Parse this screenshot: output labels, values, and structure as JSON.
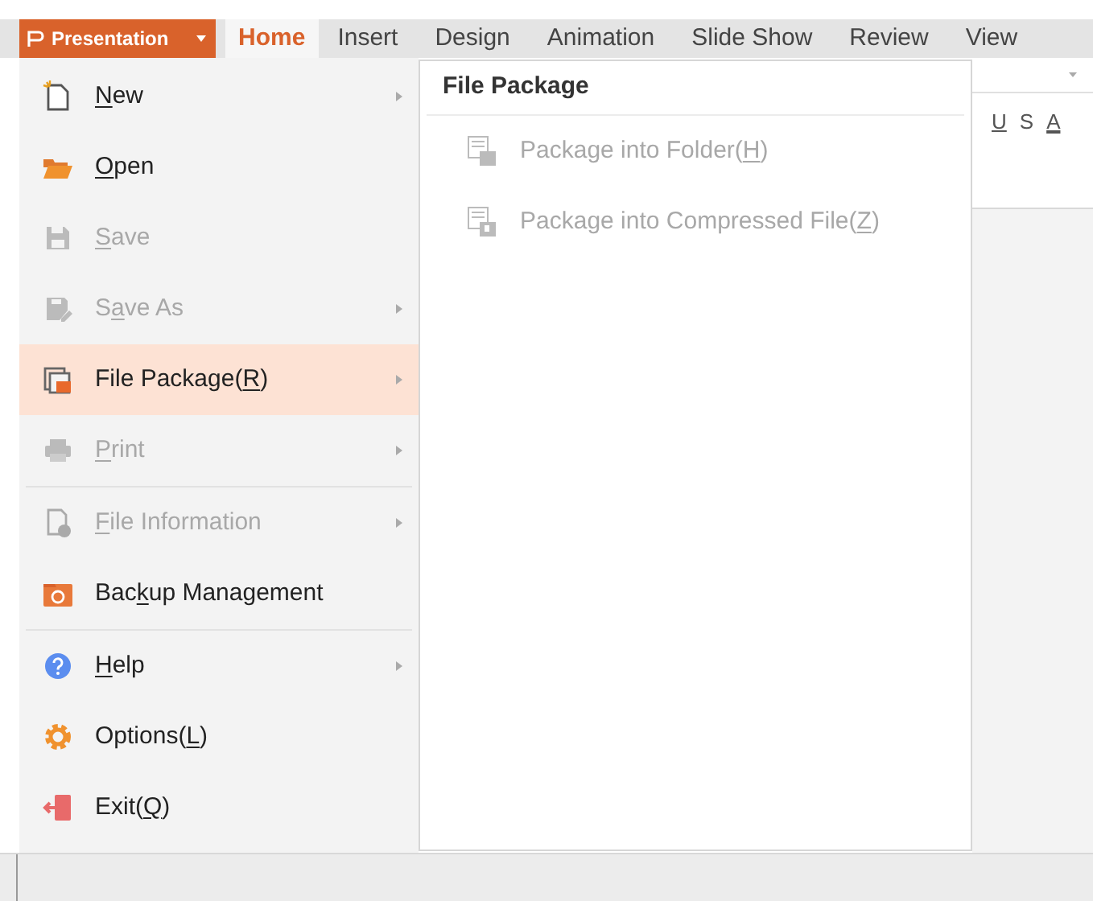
{
  "app_menu": {
    "label": "Presentation"
  },
  "tabs": [
    {
      "label": "Home",
      "selected": true
    },
    {
      "label": "Insert",
      "selected": false
    },
    {
      "label": "Design",
      "selected": false
    },
    {
      "label": "Animation",
      "selected": false
    },
    {
      "label": "Slide Show",
      "selected": false
    },
    {
      "label": "Review",
      "selected": false
    },
    {
      "label": "View",
      "selected": false
    }
  ],
  "ribbon_tools": [
    "U",
    "S",
    "A"
  ],
  "menu": [
    {
      "key": "N",
      "after": "ew",
      "disabled": false,
      "submenu": true,
      "selected": false,
      "divider_after": false
    },
    {
      "key": "O",
      "after": "pen",
      "disabled": false,
      "submenu": false,
      "selected": false,
      "divider_after": false
    },
    {
      "key": "S",
      "after": "ave",
      "disabled": true,
      "submenu": false,
      "selected": false,
      "divider_after": false
    },
    {
      "before": "S",
      "key": "a",
      "after": "ve As",
      "disabled": true,
      "submenu": true,
      "selected": false,
      "divider_after": false
    },
    {
      "before": "File Package(",
      "key": "R",
      "after": ")",
      "disabled": false,
      "submenu": true,
      "selected": true,
      "divider_after": false
    },
    {
      "key": "P",
      "after": "rint",
      "disabled": true,
      "submenu": true,
      "selected": false,
      "divider_after": true
    },
    {
      "key": "F",
      "after": "ile Information",
      "disabled": true,
      "submenu": true,
      "selected": false,
      "divider_after": false
    },
    {
      "before": "Bac",
      "key": "k",
      "after": "up Management",
      "disabled": false,
      "submenu": false,
      "selected": false,
      "divider_after": true
    },
    {
      "key": "H",
      "after": "elp",
      "disabled": false,
      "submenu": true,
      "selected": false,
      "divider_after": false
    },
    {
      "before": "Options(",
      "key": "L",
      "after": ")",
      "disabled": false,
      "submenu": false,
      "selected": false,
      "divider_after": false
    },
    {
      "before": "Exit(",
      "key": "Q",
      "after": ")",
      "disabled": false,
      "submenu": false,
      "selected": false,
      "divider_after": false
    }
  ],
  "submenu": {
    "title": "File Package",
    "items": [
      {
        "before": "Package into Folder(",
        "key": "H",
        "after": ")",
        "disabled": true
      },
      {
        "before": "Package into Compressed File(",
        "key": "Z",
        "after": ")",
        "disabled": true
      }
    ]
  }
}
